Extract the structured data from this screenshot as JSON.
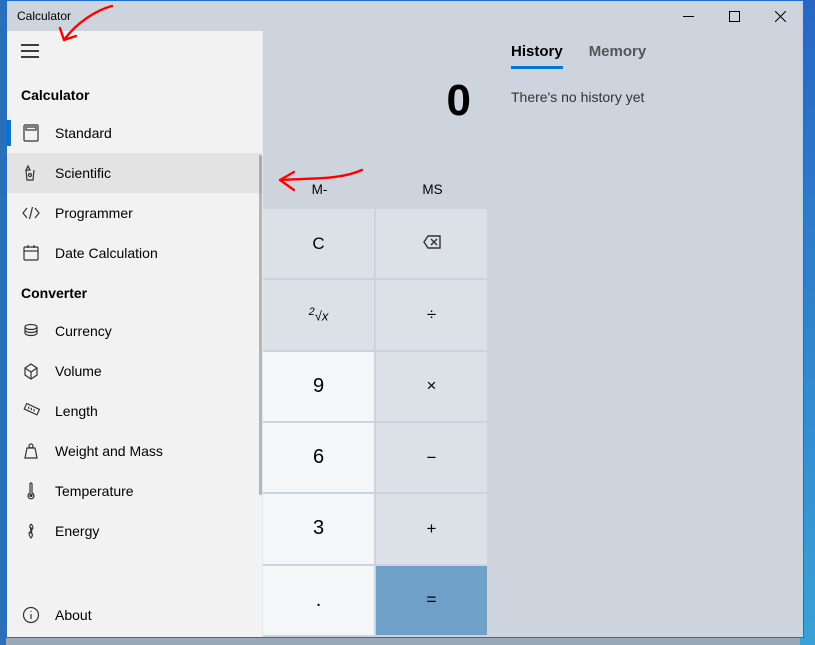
{
  "window": {
    "title": "Calculator"
  },
  "nav": {
    "section1_label": "Calculator",
    "section2_label": "Converter",
    "items_calc": [
      {
        "label": "Standard",
        "icon": "standard"
      },
      {
        "label": "Scientific",
        "icon": "scientific"
      },
      {
        "label": "Programmer",
        "icon": "programmer"
      },
      {
        "label": "Date Calculation",
        "icon": "date"
      }
    ],
    "items_conv": [
      {
        "label": "Currency",
        "icon": "currency"
      },
      {
        "label": "Volume",
        "icon": "volume"
      },
      {
        "label": "Length",
        "icon": "length"
      },
      {
        "label": "Weight and Mass",
        "icon": "weight"
      },
      {
        "label": "Temperature",
        "icon": "temperature"
      },
      {
        "label": "Energy",
        "icon": "energy"
      }
    ],
    "about_label": "About"
  },
  "display": {
    "value": "0"
  },
  "memory": {
    "m_minus": "M-",
    "ms": "MS"
  },
  "keys": {
    "c": "C",
    "back": "⌫",
    "root": "²√x",
    "div": "÷",
    "nine": "9",
    "mul": "×",
    "six": "6",
    "sub": "−",
    "three": "3",
    "add": "+",
    "dot": ".",
    "eq": "="
  },
  "history": {
    "tab_history": "History",
    "tab_memory": "Memory",
    "empty_text": "There's no history yet"
  }
}
